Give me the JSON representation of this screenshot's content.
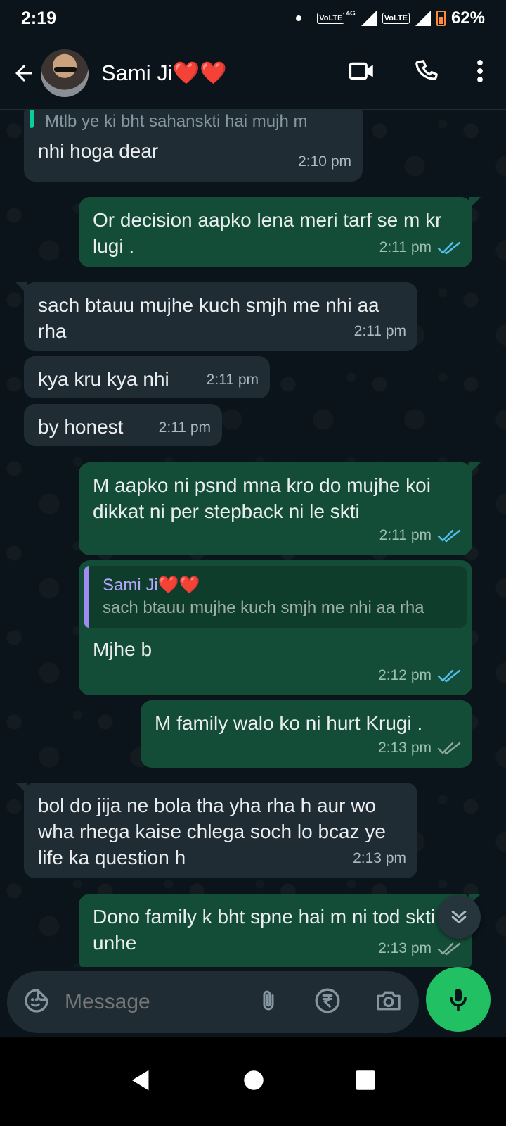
{
  "status_bar": {
    "time": "2:19",
    "volte1": "VoLTE",
    "lte": "4G",
    "volte2": "VoLTE",
    "battery": "62%"
  },
  "header": {
    "contact_name": "Sami Ji❤️❤️",
    "icons": [
      "back-arrow-icon",
      "video-call-icon",
      "voice-call-icon",
      "more-options-icon"
    ]
  },
  "messages": [
    {
      "dir": "in",
      "quoted_preview": "Mtlb ye ki bht sahanskti hai mujh m",
      "text": "nhi hoga dear",
      "time": "2:10 pm"
    },
    {
      "dir": "out",
      "text": "Or decision aapko lena meri tarf se m kr lugi .",
      "time": "2:11 pm",
      "status": "read"
    },
    {
      "dir": "in",
      "text": "sach btauu mujhe kuch smjh me nhi aa rha",
      "time": "2:11 pm"
    },
    {
      "dir": "in",
      "text": "kya kru kya nhi",
      "time": "2:11 pm"
    },
    {
      "dir": "in",
      "text": "by honest",
      "time": "2:11 pm"
    },
    {
      "dir": "out",
      "text": "M aapko ni psnd mna kro do mujhe koi dikkat ni per stepback ni le skti",
      "time": "2:11 pm",
      "status": "read"
    },
    {
      "dir": "out",
      "reply_to": {
        "name": "Sami Ji❤️❤️",
        "text": "sach btauu mujhe kuch smjh me nhi aa rha"
      },
      "text": "Mjhe b",
      "time": "2:12 pm",
      "status": "read"
    },
    {
      "dir": "out",
      "text": "M family walo ko ni hurt Krugi .",
      "time": "2:13 pm",
      "status": "delivered"
    },
    {
      "dir": "in",
      "text": "bol do jija ne bola tha yha rha h aur wo wha rhega kaise chlega soch lo bcaz ye life ka question h",
      "time": "2:13 pm"
    },
    {
      "dir": "out",
      "text": "Dono family k bht spne hai m ni tod skti unhe",
      "time": "2:13 pm",
      "status": "delivered"
    }
  ],
  "composer": {
    "placeholder": "Message",
    "icons": [
      "sticker-icon",
      "attach-icon",
      "rupee-payment-icon",
      "camera-icon",
      "mic-icon"
    ]
  },
  "colors": {
    "incoming": "#1f2c34",
    "outgoing": "#144d37",
    "read_ticks": "#53bdeb",
    "delivered_ticks": "#8fa89e",
    "accent": "#21c063"
  }
}
